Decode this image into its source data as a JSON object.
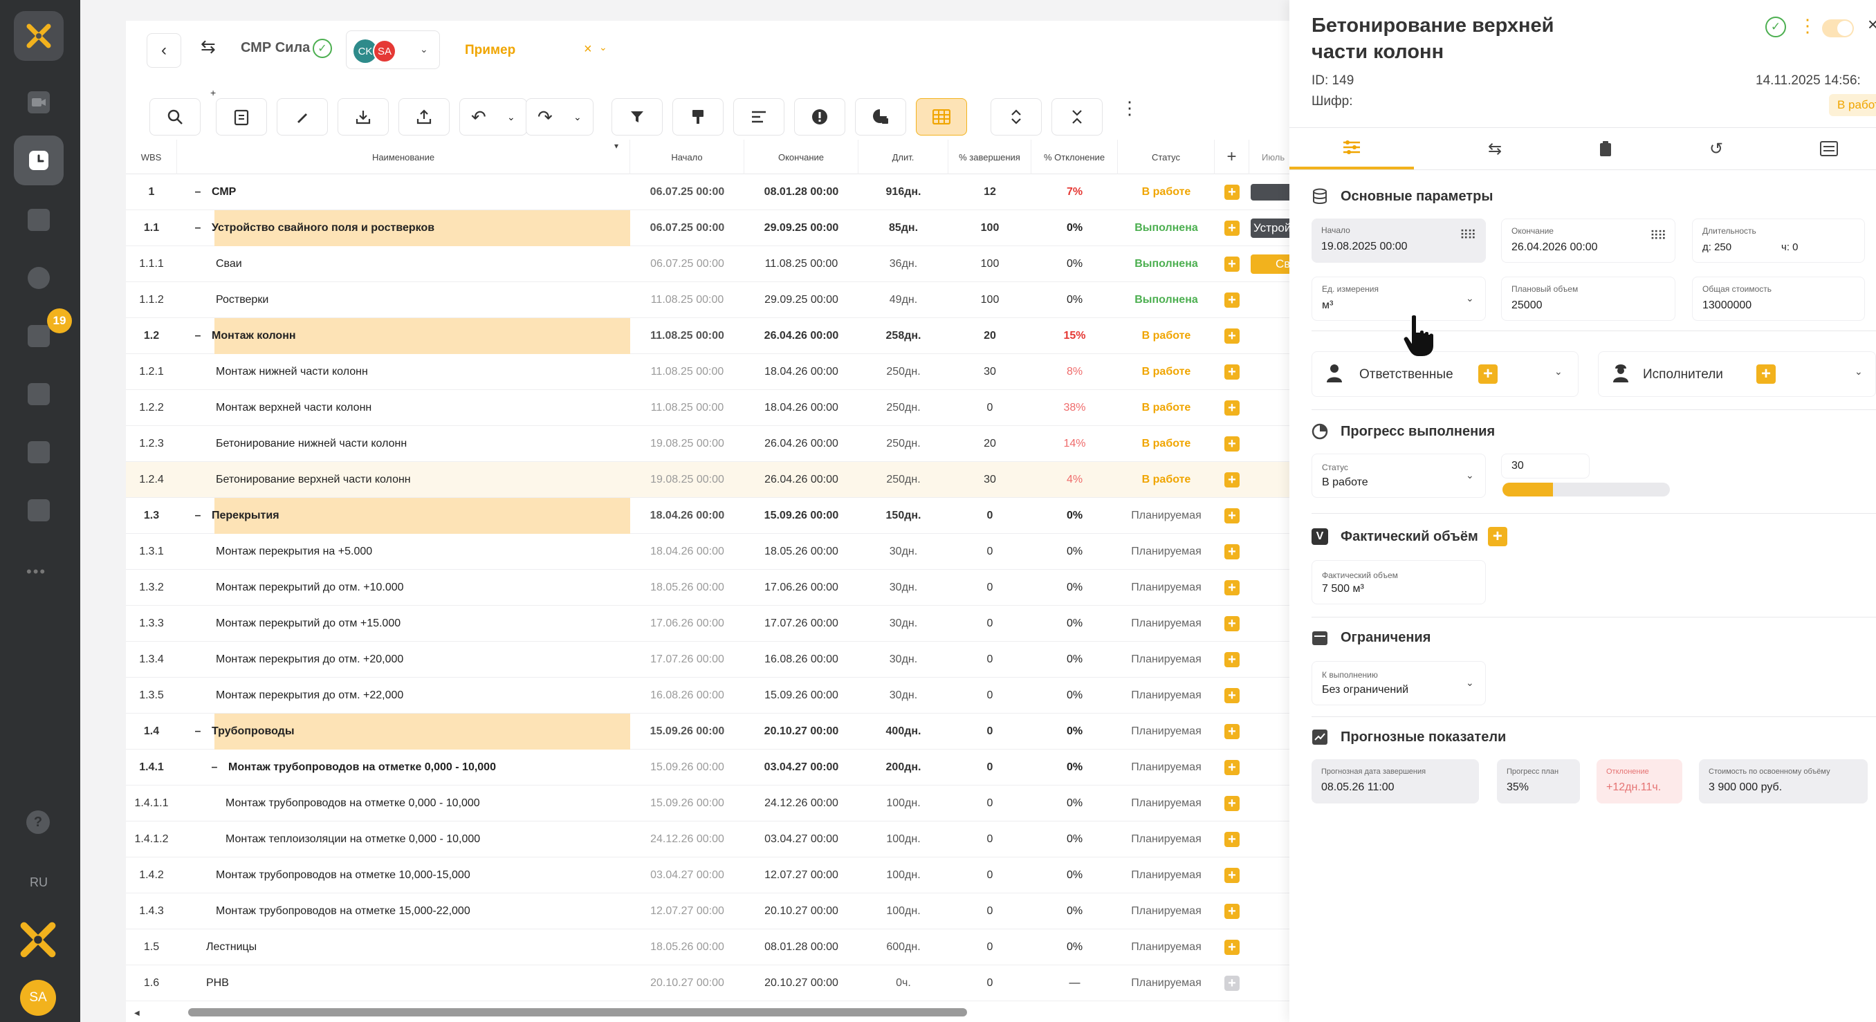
{
  "rail": {
    "badge_count": "19",
    "lang": "RU",
    "user_initials": "SA"
  },
  "header": {
    "project": "СМР Сила",
    "avatars": [
      "CK",
      "SA"
    ],
    "filter": "Пример"
  },
  "grid": {
    "columns": {
      "wbs": "WBS",
      "name": "Наименование",
      "start": "Начало",
      "end": "Окончание",
      "dur": "Длит.",
      "pct": "% завершения",
      "dev": "% Отклонение",
      "status": "Статус",
      "gantt_month": "Июль"
    },
    "gantt_bars": [
      "Устройс",
      "Св"
    ],
    "rows": [
      {
        "wbs": "1",
        "name": "СМР",
        "start": "06.07.25 00:00",
        "end": "08.01.28 00:00",
        "dur": "916дн.",
        "pct": "12",
        "dev": "7%",
        "status": "В работе",
        "level": 0,
        "bold": true,
        "group": false,
        "toggle": "–"
      },
      {
        "wbs": "1.1",
        "name": "Устройство свайного поля и ростверков",
        "start": "06.07.25 00:00",
        "end": "29.09.25 00:00",
        "dur": "85дн.",
        "pct": "100",
        "dev": "0%",
        "status": "Выполнена",
        "level": 1,
        "bold": true,
        "group": true,
        "toggle": "–"
      },
      {
        "wbs": "1.1.1",
        "name": "Сваи",
        "start": "06.07.25 00:00",
        "end": "11.08.25 00:00",
        "dur": "36дн.",
        "pct": "100",
        "dev": "0%",
        "status": "Выполнена",
        "level": 2,
        "bold": false,
        "group": false,
        "toggle": ""
      },
      {
        "wbs": "1.1.2",
        "name": "Ростверки",
        "start": "11.08.25 00:00",
        "end": "29.09.25 00:00",
        "dur": "49дн.",
        "pct": "100",
        "dev": "0%",
        "status": "Выполнена",
        "level": 2,
        "bold": false,
        "group": false,
        "toggle": ""
      },
      {
        "wbs": "1.2",
        "name": "Монтаж колонн",
        "start": "11.08.25 00:00",
        "end": "26.04.26 00:00",
        "dur": "258дн.",
        "pct": "20",
        "dev": "15%",
        "status": "В работе",
        "level": 1,
        "bold": true,
        "group": true,
        "toggle": "–"
      },
      {
        "wbs": "1.2.1",
        "name": "Монтаж нижней части колонн",
        "start": "11.08.25 00:00",
        "end": "18.04.26 00:00",
        "dur": "250дн.",
        "pct": "30",
        "dev": "8%",
        "status": "В работе",
        "level": 2,
        "bold": false,
        "group": false,
        "toggle": ""
      },
      {
        "wbs": "1.2.2",
        "name": "Монтаж верхней части колонн",
        "start": "11.08.25 00:00",
        "end": "18.04.26 00:00",
        "dur": "250дн.",
        "pct": "0",
        "dev": "38%",
        "status": "В работе",
        "level": 2,
        "bold": false,
        "group": false,
        "toggle": ""
      },
      {
        "wbs": "1.2.3",
        "name": "Бетонирование нижней части колонн",
        "start": "19.08.25 00:00",
        "end": "26.04.26 00:00",
        "dur": "250дн.",
        "pct": "20",
        "dev": "14%",
        "status": "В работе",
        "level": 2,
        "bold": false,
        "group": false,
        "toggle": ""
      },
      {
        "wbs": "1.2.4",
        "name": "Бетонирование верхней части колонн",
        "start": "19.08.25 00:00",
        "end": "26.04.26 00:00",
        "dur": "250дн.",
        "pct": "30",
        "dev": "4%",
        "status": "В работе",
        "level": 2,
        "bold": false,
        "group": false,
        "toggle": "",
        "selected": true
      },
      {
        "wbs": "1.3",
        "name": "Перекрытия",
        "start": "18.04.26 00:00",
        "end": "15.09.26 00:00",
        "dur": "150дн.",
        "pct": "0",
        "dev": "0%",
        "status": "Планируемая",
        "level": 1,
        "bold": true,
        "group": true,
        "toggle": "–"
      },
      {
        "wbs": "1.3.1",
        "name": "Монтаж перекрытия на +5.000",
        "start": "18.04.26 00:00",
        "end": "18.05.26 00:00",
        "dur": "30дн.",
        "pct": "0",
        "dev": "0%",
        "status": "Планируемая",
        "level": 2,
        "bold": false,
        "group": false,
        "toggle": ""
      },
      {
        "wbs": "1.3.2",
        "name": "Монтаж перекрытий до отм. +10.000",
        "start": "18.05.26 00:00",
        "end": "17.06.26 00:00",
        "dur": "30дн.",
        "pct": "0",
        "dev": "0%",
        "status": "Планируемая",
        "level": 2,
        "bold": false,
        "group": false,
        "toggle": ""
      },
      {
        "wbs": "1.3.3",
        "name": "Монтаж перекрытий до отм +15.000",
        "start": "17.06.26 00:00",
        "end": "17.07.26 00:00",
        "dur": "30дн.",
        "pct": "0",
        "dev": "0%",
        "status": "Планируемая",
        "level": 2,
        "bold": false,
        "group": false,
        "toggle": ""
      },
      {
        "wbs": "1.3.4",
        "name": "Монтаж перекрытия до отм. +20,000",
        "start": "17.07.26 00:00",
        "end": "16.08.26 00:00",
        "dur": "30дн.",
        "pct": "0",
        "dev": "0%",
        "status": "Планируемая",
        "level": 2,
        "bold": false,
        "group": false,
        "toggle": ""
      },
      {
        "wbs": "1.3.5",
        "name": "Монтаж перекрытия до отм. +22,000",
        "start": "16.08.26 00:00",
        "end": "15.09.26 00:00",
        "dur": "30дн.",
        "pct": "0",
        "dev": "0%",
        "status": "Планируемая",
        "level": 2,
        "bold": false,
        "group": false,
        "toggle": ""
      },
      {
        "wbs": "1.4",
        "name": "Трубопроводы",
        "start": "15.09.26 00:00",
        "end": "20.10.27 00:00",
        "dur": "400дн.",
        "pct": "0",
        "dev": "0%",
        "status": "Планируемая",
        "level": 1,
        "bold": true,
        "group": true,
        "toggle": "–"
      },
      {
        "wbs": "1.4.1",
        "name": "Монтаж трубопроводов на отметке 0,000 - 10,000",
        "start": "15.09.26 00:00",
        "end": "03.04.27 00:00",
        "dur": "200дн.",
        "pct": "0",
        "dev": "0%",
        "status": "Планируемая",
        "level": 2,
        "bold": true,
        "group": false,
        "toggle": "–"
      },
      {
        "wbs": "1.4.1.1",
        "name": "Монтаж трубопроводов на отметке 0,000 - 10,000",
        "start": "15.09.26 00:00",
        "end": "24.12.26 00:00",
        "dur": "100дн.",
        "pct": "0",
        "dev": "0%",
        "status": "Планируемая",
        "level": 3,
        "bold": false,
        "group": false,
        "toggle": ""
      },
      {
        "wbs": "1.4.1.2",
        "name": "Монтаж теплоизоляции на отметке 0,000 - 10,000",
        "start": "24.12.26 00:00",
        "end": "03.04.27 00:00",
        "dur": "100дн.",
        "pct": "0",
        "dev": "0%",
        "status": "Планируемая",
        "level": 3,
        "bold": false,
        "group": false,
        "toggle": ""
      },
      {
        "wbs": "1.4.2",
        "name": "Монтаж трубопроводов на отметке 10,000-15,000",
        "start": "03.04.27 00:00",
        "end": "12.07.27 00:00",
        "dur": "100дн.",
        "pct": "0",
        "dev": "0%",
        "status": "Планируемая",
        "level": 2,
        "bold": false,
        "group": false,
        "toggle": ""
      },
      {
        "wbs": "1.4.3",
        "name": "Монтаж трубопроводов на отметке 15,000-22,000",
        "start": "12.07.27 00:00",
        "end": "20.10.27 00:00",
        "dur": "100дн.",
        "pct": "0",
        "dev": "0%",
        "status": "Планируемая",
        "level": 2,
        "bold": false,
        "group": false,
        "toggle": ""
      },
      {
        "wbs": "1.5",
        "name": "Лестницы",
        "start": "18.05.26 00:00",
        "end": "08.01.28 00:00",
        "dur": "600дн.",
        "pct": "0",
        "dev": "0%",
        "status": "Планируемая",
        "level": 1,
        "bold": false,
        "group": false,
        "toggle": ""
      },
      {
        "wbs": "1.6",
        "name": "PHB",
        "start": "20.10.27 00:00",
        "end": "20.10.27 00:00",
        "dur": "0ч.",
        "pct": "0",
        "dev": "—",
        "status": "Планируемая",
        "level": 1,
        "bold": false,
        "group": false,
        "toggle": "",
        "disabled": true
      }
    ]
  },
  "panel": {
    "title_line1": "Бетонирование верхней",
    "title_line2": "части колонн",
    "id": "ID: 149",
    "code": "Шифр:",
    "date": "14.11.2025 14:56:",
    "status_badge": "В работе",
    "sections": {
      "main": "Основные параметры",
      "responsible": "Ответственные",
      "executors": "Исполнители",
      "progress": "Прогресс выполнения",
      "fact": "Фактический объём",
      "limits": "Ограничения",
      "forecast": "Прогнозные показатели"
    },
    "fields": {
      "start_label": "Начало",
      "start_value": "19.08.2025 00:00",
      "end_label": "Окончание",
      "end_value": "26.04.2026 00:00",
      "dur_label": "Длительность",
      "dur_days": "д: 250",
      "dur_hours": "ч: 0",
      "unit_label": "Ед. измерения",
      "unit_value": "м³",
      "plan_label": "Плановый объем",
      "plan_value": "25000",
      "cost_label": "Общая стоимость",
      "cost_value": "13000000",
      "status_label": "Статус",
      "status_value": "В работе",
      "progress_value": "30",
      "progress_fraction": 0.3,
      "fact_label": "Фактический объем",
      "fact_value": "7 500 м³",
      "limit_label": "К выполнению",
      "limit_value": "Без ограничений",
      "fc1_label": "Прогнозная дата завершения",
      "fc1_value": "08.05.26 11:00",
      "fc2_label": "Прогресс план",
      "fc2_value": "35%",
      "fc3_label": "Отклонение",
      "fc3_value": "+12дн.11ч.",
      "fc4_label": "Стоимость по освоенному объёму",
      "fc4_value": "3 900 000 руб."
    }
  },
  "colors": {
    "accent": "#f2b21d",
    "rail": "#2f3133",
    "group_row": "#fde3b6",
    "status_work": "#f0a500",
    "status_done": "#4caf50"
  }
}
